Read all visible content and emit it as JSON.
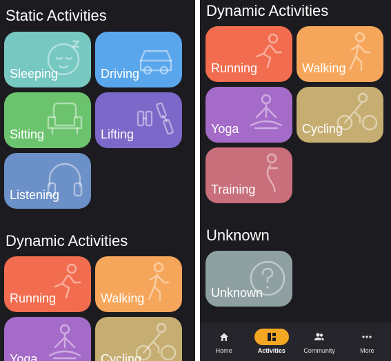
{
  "left": {
    "static_title": "Static Activities",
    "static_tiles": [
      {
        "label": "Sleeping",
        "icon": "sleeping-face-icon",
        "color": "#76c8c1"
      },
      {
        "label": "Driving",
        "icon": "car-icon",
        "color": "#5aa6ec"
      },
      {
        "label": "Sitting",
        "icon": "armchair-icon",
        "color": "#6cc36e"
      },
      {
        "label": "Lifting",
        "icon": "dumbbell-icon",
        "color": "#7b68c8"
      },
      {
        "label": "Listening",
        "icon": "headphones-icon",
        "color": "#6c90c8"
      }
    ],
    "dynamic_title": "Dynamic Activities",
    "dynamic_tiles": [
      {
        "label": "Running",
        "icon": "running-person-icon",
        "color": "#f26d4f"
      },
      {
        "label": "Walking",
        "icon": "walking-person-icon",
        "color": "#f6a65a"
      },
      {
        "label": "Yoga",
        "icon": "yoga-pose-icon",
        "color": "#a56bc9"
      },
      {
        "label": "Cycling",
        "icon": "cyclist-icon",
        "color": "#c6ae72"
      }
    ]
  },
  "right": {
    "dynamic_title": "Dynamic Activities",
    "dynamic_tiles": [
      {
        "label": "Running",
        "icon": "running-person-icon",
        "color": "#f26d4f"
      },
      {
        "label": "Walking",
        "icon": "walking-person-icon",
        "color": "#f6a65a"
      },
      {
        "label": "Yoga",
        "icon": "yoga-pose-icon",
        "color": "#a56bc9"
      },
      {
        "label": "Cycling",
        "icon": "cyclist-icon",
        "color": "#c6ae72"
      },
      {
        "label": "Training",
        "icon": "training-person-icon",
        "color": "#c96f7c"
      }
    ],
    "unknown_title": "Unknown",
    "unknown_tile": {
      "label": "Unknown",
      "icon": "question-circle-icon",
      "color": "#8ea0a2"
    }
  },
  "bottom_nav": {
    "active_color": "#f5a623",
    "items": [
      {
        "label": "Home",
        "icon": "home-icon",
        "active": false
      },
      {
        "label": "Activities",
        "icon": "activities-grid-icon",
        "active": true
      },
      {
        "label": "Community",
        "icon": "people-icon",
        "active": false
      },
      {
        "label": "More",
        "icon": "more-dots-icon",
        "active": false
      }
    ]
  }
}
